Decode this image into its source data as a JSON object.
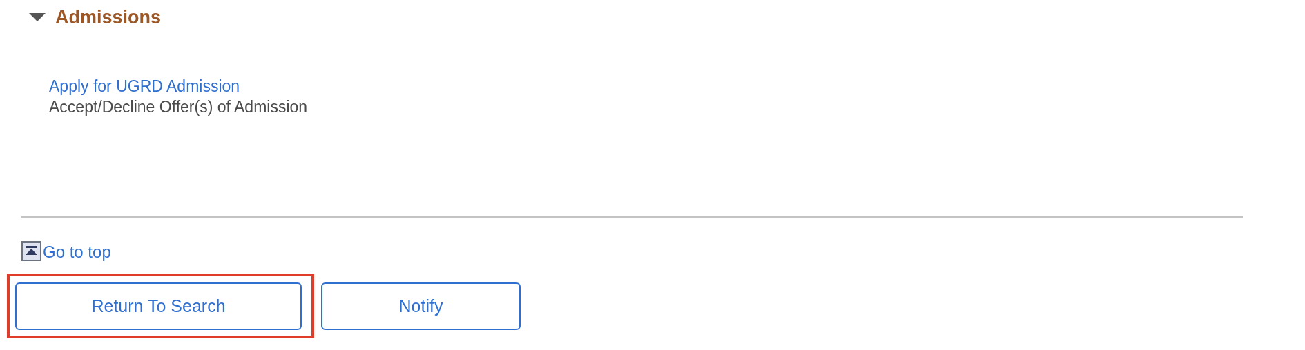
{
  "section": {
    "title": "Admissions",
    "expanded": true
  },
  "links": [
    {
      "label": "Apply for UGRD Admission",
      "kind": "link"
    },
    {
      "label": "Accept/Decline Offer(s) of Admission",
      "kind": "text"
    }
  ],
  "go_to_top": "Go to top",
  "buttons": [
    {
      "label": "Return To Search",
      "highlighted": true
    },
    {
      "label": "Notify",
      "highlighted": false
    }
  ]
}
